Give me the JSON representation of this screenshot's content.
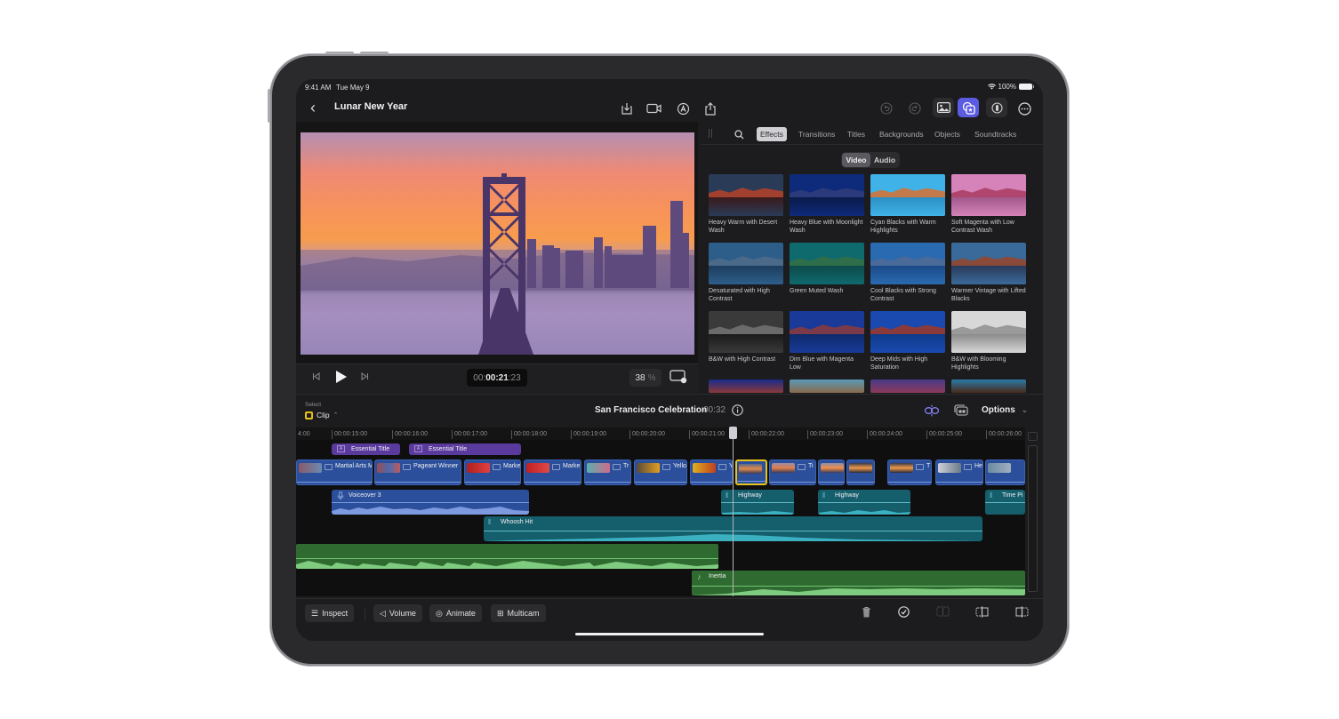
{
  "status_bar": {
    "time": "9:41 AM",
    "date": "Tue May 9",
    "battery": "100%"
  },
  "nav": {
    "title": "Lunar New Year",
    "left_icons": [
      "import-icon",
      "camera-icon",
      "voiceover-icon",
      "share-icon"
    ],
    "right_icons": [
      "undo-icon",
      "redo-icon",
      "photos-icon",
      "browser-icon",
      "enhance-icon",
      "more-icon"
    ]
  },
  "viewer": {
    "timecode_dim": "00:",
    "timecode_bold": "00:21",
    "timecode_frames": ":23",
    "zoom_value": "38",
    "zoom_unit": "%"
  },
  "browser": {
    "tabs": [
      "Effects",
      "Transitions",
      "Titles",
      "Backgrounds",
      "Objects",
      "Soundtracks"
    ],
    "active_tab": "Effects",
    "segments": [
      "Video",
      "Audio"
    ],
    "active_segment": "Video",
    "effects": [
      {
        "label": "Heavy Warm with Desert Wash",
        "sky": "#2a3b58",
        "mtn": "#a2402f",
        "water": "#3b1a1a"
      },
      {
        "label": "Heavy Blue with Moonlight Wash",
        "sky": "#0e2a7a",
        "mtn": "#2b3a7a",
        "water": "#0a1a4a"
      },
      {
        "label": "Cyan Blacks with Warm Highlights",
        "sky": "#3fb3e8",
        "mtn": "#c27a4a",
        "water": "#2a8fc2"
      },
      {
        "label": "Soft Magenta with Low Contrast Wash",
        "sky": "#d583b8",
        "mtn": "#b0466e",
        "water": "#a2588c"
      },
      {
        "label": "Desaturated with High Contrast",
        "sky": "#2d5e8a",
        "mtn": "#4b6a8a",
        "water": "#1d3d5e"
      },
      {
        "label": "Green Muted Wash",
        "sky": "#0f6a6e",
        "mtn": "#2f6e4a",
        "water": "#0e4a4a"
      },
      {
        "label": "Cool Blacks with Strong Contrast",
        "sky": "#2a6ab0",
        "mtn": "#4a6a9a",
        "water": "#1a4a8a"
      },
      {
        "label": "Warmer Vintage with Lifted Blacks",
        "sky": "#3a6a9a",
        "mtn": "#8a4a3a",
        "water": "#2a3a5a"
      },
      {
        "label": "B&W with High Contrast",
        "sky": "#3a3a3a",
        "mtn": "#6a6a6a",
        "water": "#1a1a1a"
      },
      {
        "label": "Dim Blue with Magenta Low",
        "sky": "#1a3a9a",
        "mtn": "#7a3a4a",
        "water": "#0e2a6a"
      },
      {
        "label": "Deep Mids with High Saturation",
        "sky": "#1a4ab0",
        "mtn": "#8a3a3a",
        "water": "#0e3a8a"
      },
      {
        "label": "B&W with Blooming Highlights",
        "sky": "#d8d8d8",
        "mtn": "#9a9a9a",
        "water": "#8a8a8a"
      }
    ]
  },
  "timeline": {
    "select_label": "Select",
    "select_value": "Clip",
    "project_name": "San Francisco Celebration",
    "duration": "00:32",
    "options_label": "Options",
    "ruler": [
      "4:00",
      "00:00:15:00",
      "00:00:16:00",
      "00:00:17:00",
      "00:00:18:00",
      "00:00:19:00",
      "00:00:20:00",
      "00:00:21:00",
      "00:00:22:00",
      "00:00:23:00",
      "00:00:24:00",
      "00:00:25:00",
      "00:00:26:00"
    ],
    "titles": [
      "Essential Title",
      "Essential Title"
    ],
    "video_clips": [
      "Martial Arts Mura",
      "Pageant Winner",
      "Marke",
      "Marke",
      "Tr",
      "Yello",
      "Y",
      "",
      "Ti",
      "",
      "",
      "T",
      "He",
      ""
    ],
    "audio_clips": {
      "voiceover": "Voiceover 3",
      "highway1": "Highway",
      "highway2": "Highway",
      "time": "Time Pi",
      "whoosh": "Whoosh Hit",
      "inertia": "Inertia"
    }
  },
  "toolbar": {
    "inspect": "Inspect",
    "volume": "Volume",
    "animate": "Animate",
    "multicam": "Multicam"
  }
}
